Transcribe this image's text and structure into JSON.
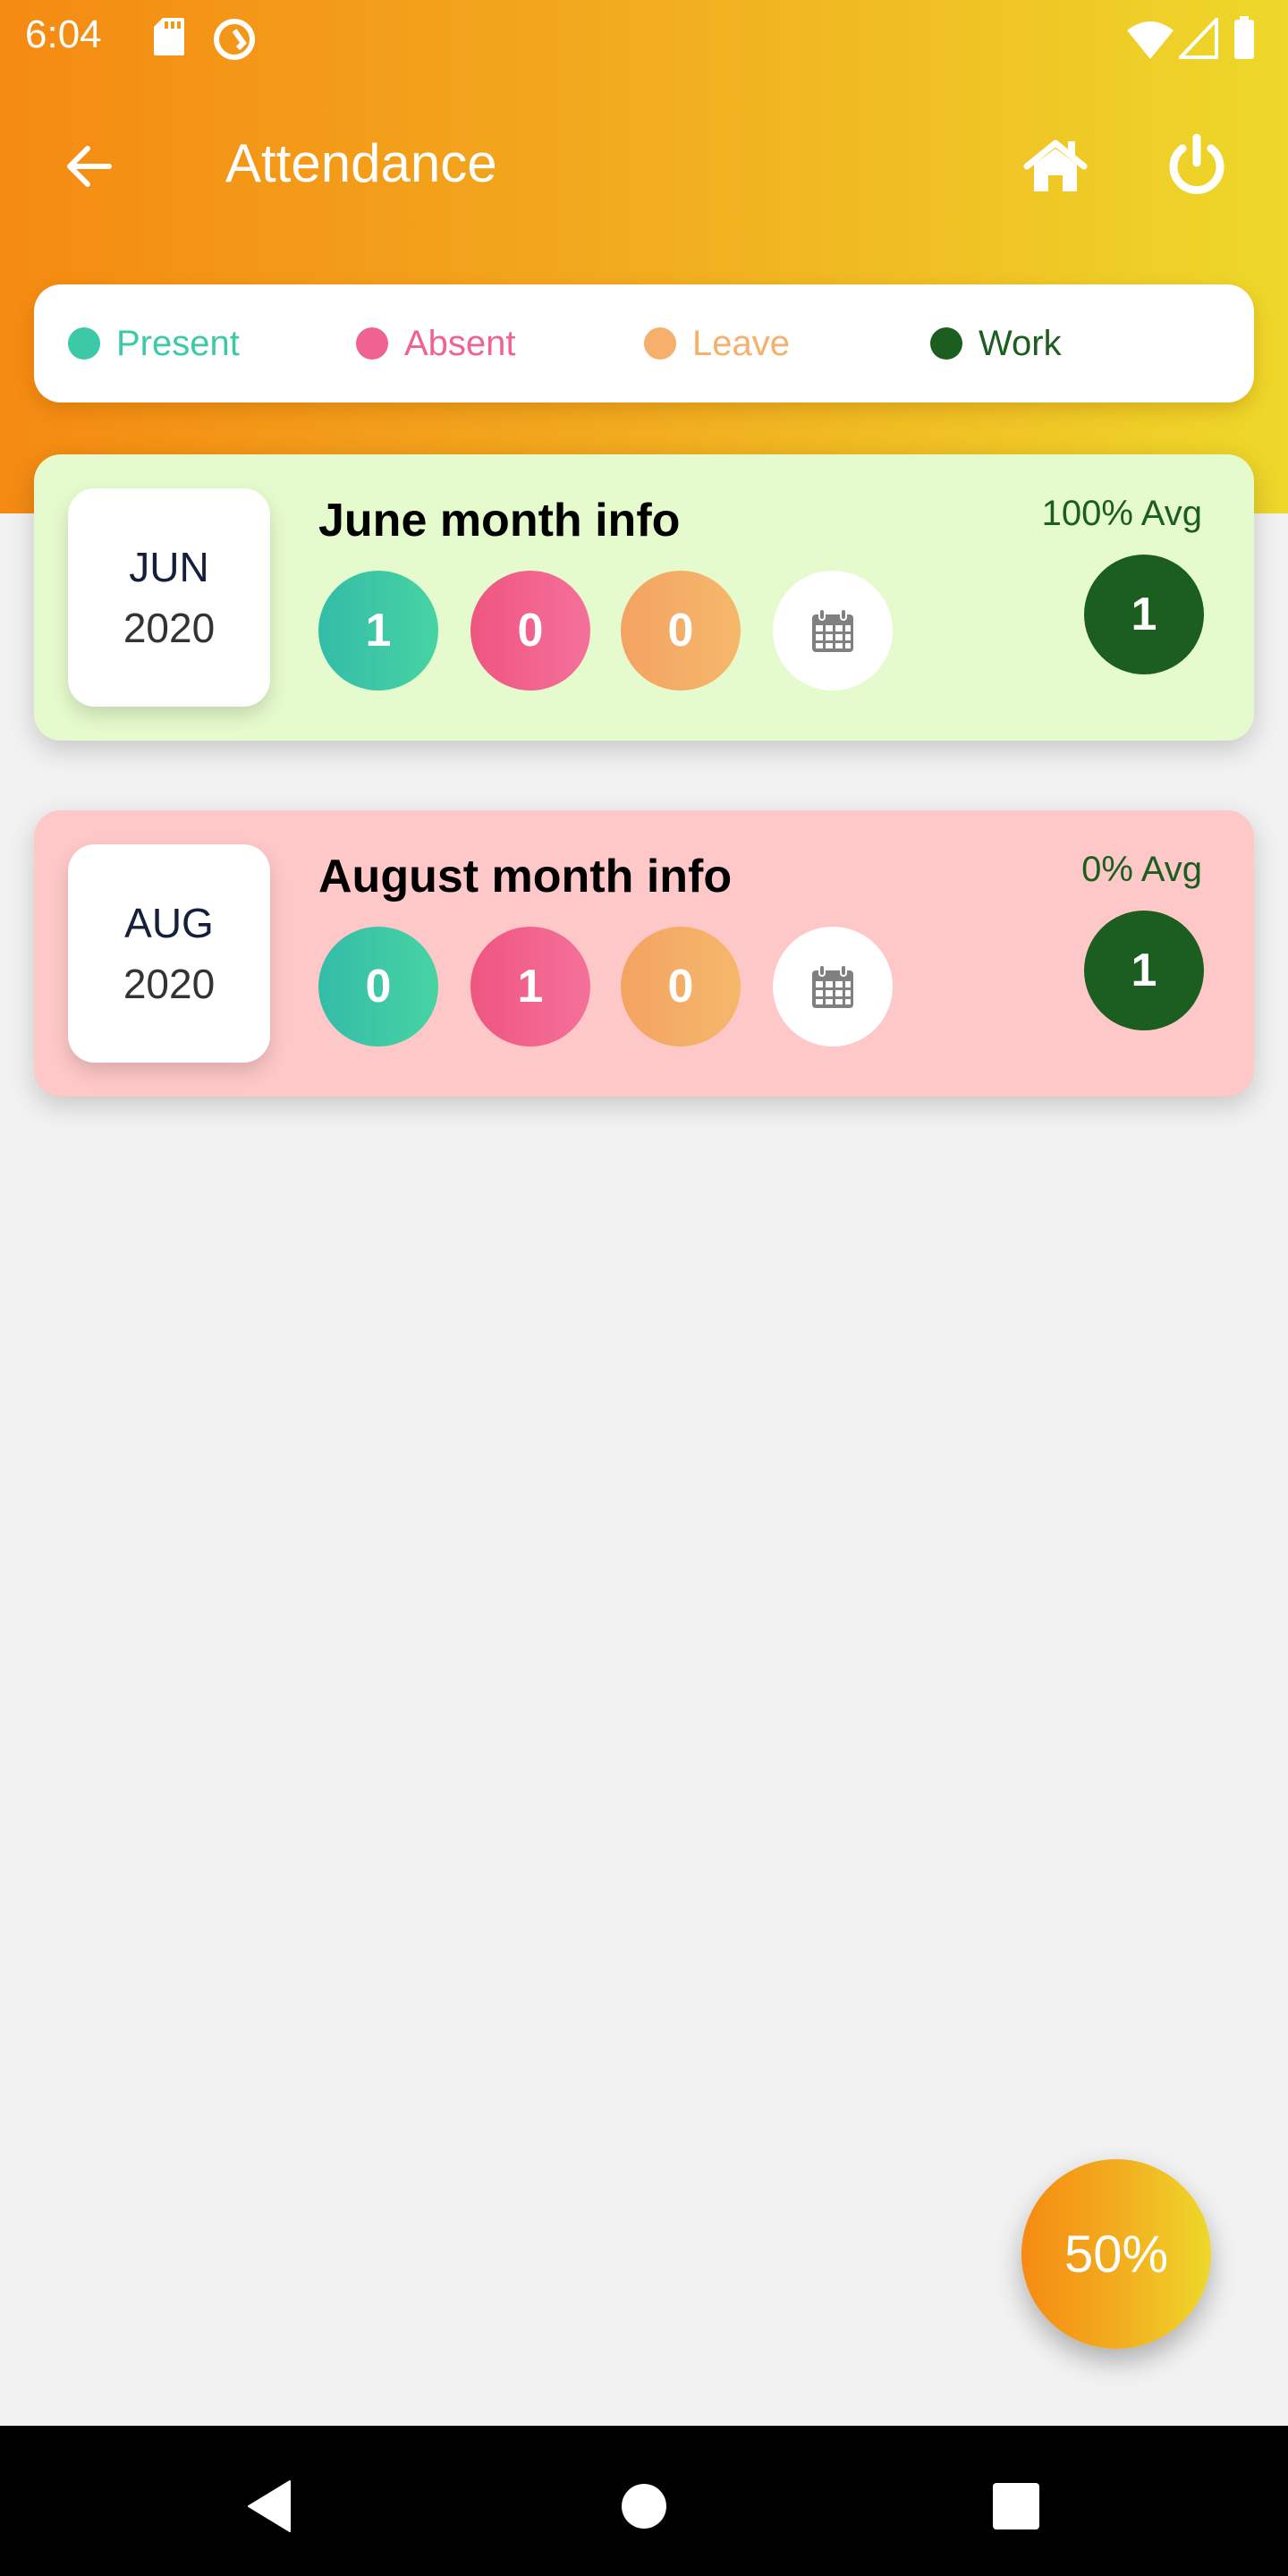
{
  "status_bar": {
    "time": "6:04",
    "left_icons": [
      "sd-card-icon",
      "data-saver-icon"
    ],
    "right_icons": [
      "wifi-icon",
      "cellular-signal-icon",
      "battery-icon"
    ]
  },
  "header": {
    "title": "Attendance",
    "back_icon": "arrow-left-icon",
    "home_icon": "home-icon",
    "power_icon": "power-icon"
  },
  "legend": [
    {
      "label": "Present",
      "color": "#3cc9a8"
    },
    {
      "label": "Absent",
      "color": "#f06292"
    },
    {
      "label": "Leave",
      "color": "#f6b06b"
    },
    {
      "label": "Work",
      "color": "#1b5e20"
    }
  ],
  "months": [
    {
      "month": "JUN",
      "year": "2020",
      "title": "June month info",
      "present": "1",
      "absent": "0",
      "leave": "0",
      "calendar_icon": "calendar-icon",
      "avg": "100% Avg",
      "work": "1",
      "background": "#e6fbcd"
    },
    {
      "month": "AUG",
      "year": "2020",
      "title": "August month info",
      "present": "0",
      "absent": "1",
      "leave": "0",
      "calendar_icon": "calendar-icon",
      "avg": "0% Avg",
      "work": "1",
      "background": "#ffc8c8"
    }
  ],
  "fab": {
    "label": "50%"
  },
  "nav_bar": {
    "back": "nav-back-icon",
    "home": "nav-home-icon",
    "recents": "nav-recents-icon"
  }
}
